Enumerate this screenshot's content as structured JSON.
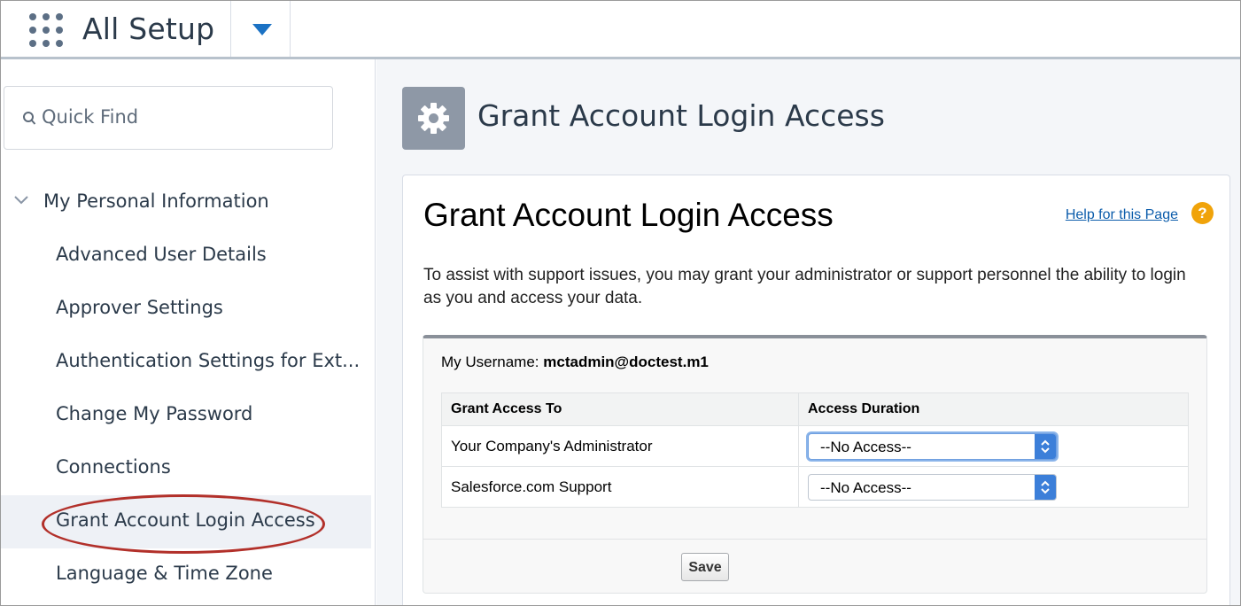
{
  "topbar": {
    "app_title": "All Setup",
    "app_launcher_icon": "app-launcher-grid-icon",
    "dropdown_icon": "chevron-down-icon"
  },
  "sidebar": {
    "search": {
      "placeholder": "Quick Find",
      "icon": "search-icon"
    },
    "section": {
      "label": "My Personal Information",
      "icon": "chevron-down-icon"
    },
    "items": [
      {
        "label": "Advanced User Details"
      },
      {
        "label": "Approver Settings"
      },
      {
        "label": "Authentication Settings for Ext..."
      },
      {
        "label": "Change My Password"
      },
      {
        "label": "Connections"
      },
      {
        "label": "Grant Account Login Access",
        "selected": true
      },
      {
        "label": "Language & Time Zone"
      }
    ]
  },
  "page_header": {
    "icon": "gear-icon",
    "title": "Grant Account Login Access"
  },
  "panel": {
    "title": "Grant Account Login Access",
    "help_link": "Help for this Page",
    "help_icon": "question-icon",
    "description": "To assist with support issues, you may grant your administrator or support personnel the ability to login as you and access your data.",
    "username_label": "My Username:",
    "username_value": "mctadmin@doctest.m1",
    "table": {
      "headers": [
        "Grant Access To",
        "Access Duration"
      ],
      "rows": [
        {
          "grant_to": "Your Company's Administrator",
          "duration": "--No Access--"
        },
        {
          "grant_to": "Salesforce.com Support",
          "duration": "--No Access--"
        }
      ]
    },
    "save_label": "Save"
  },
  "colors": {
    "accent": "#1b72c4",
    "highlight_oval": "#b2302a",
    "help_icon": "#f0a30a",
    "header_icon_bg": "#8e98a6"
  }
}
